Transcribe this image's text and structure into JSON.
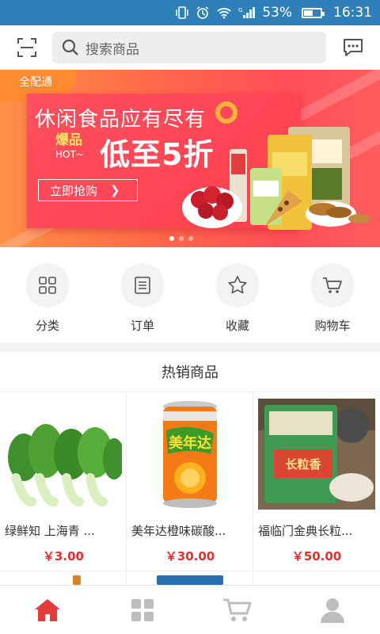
{
  "status_bar": {
    "battery": "53%",
    "time": "16:31",
    "battery_level": 0.53
  },
  "search": {
    "placeholder": "搜索商品"
  },
  "banner": {
    "corner_tag": "全配通",
    "headline": "休闲食品应有尽有",
    "hot_label": "爆品",
    "hot_sub": "HOT~",
    "discount": "低至5折",
    "cta": "立即抢购",
    "dot_count": 3,
    "active_dot": 0
  },
  "quick_nav": [
    {
      "label": "分类",
      "icon": "grid-icon"
    },
    {
      "label": "订单",
      "icon": "document-icon"
    },
    {
      "label": "收藏",
      "icon": "star-icon"
    },
    {
      "label": "购物车",
      "icon": "cart-icon"
    }
  ],
  "hot_products": {
    "title": "热销商品",
    "items": [
      {
        "name": "绿鲜知 上海青 ...",
        "price": "￥3.00",
        "image": "bok-choy"
      },
      {
        "name": "美年达橙味碳酸...",
        "price": "￥30.00",
        "image": "orange-soda-can"
      },
      {
        "name": "福临门金典长粒...",
        "price": "￥50.00",
        "image": "rice-bag"
      }
    ]
  },
  "tab_bar": [
    {
      "name": "home",
      "icon": "home-icon",
      "active": true
    },
    {
      "name": "category",
      "icon": "grid-icon",
      "active": false
    },
    {
      "name": "cart",
      "icon": "cart-icon",
      "active": false
    },
    {
      "name": "profile",
      "icon": "user-icon",
      "active": false
    }
  ],
  "colors": {
    "accent": "#e53b3b",
    "status_bar": "#2f80b8",
    "price": "#e03131",
    "inactive_icon": "#bdbdbd"
  }
}
